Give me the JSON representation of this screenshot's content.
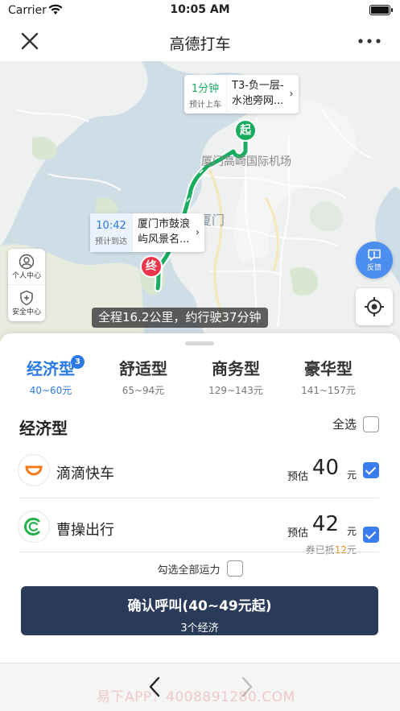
{
  "status_bar": {
    "carrier": "Carrier",
    "time": "10:05 AM"
  },
  "nav": {
    "title": "高德打车"
  },
  "map": {
    "pickup_callout": {
      "eta": "1分钟",
      "eta_label": "预计上车",
      "place_line1": "T3-负一层-",
      "place_line2": "水池旁网..."
    },
    "dropoff_callout": {
      "time": "10:42",
      "time_label": "预计到达",
      "place_line1": "厦门市鼓浪",
      "place_line2": "屿风景名..."
    },
    "start_marker": "起",
    "end_marker": "终",
    "label_airport": "厦门高崎国际机场",
    "label_city": "厦门",
    "personal_center": "个人中心",
    "safety_center": "安全中心",
    "feedback": "反馈",
    "route_summary": "全程16.2公里，约行驶37分钟"
  },
  "tabs": [
    {
      "name": "经济型",
      "price": "40~60元",
      "badge": "3",
      "active": true
    },
    {
      "name": "舒适型",
      "price": "65~94元"
    },
    {
      "name": "商务型",
      "price": "129~143元"
    },
    {
      "name": "豪华型",
      "price": "141~157元"
    }
  ],
  "section": {
    "title": "经济型",
    "select_all": "全选"
  },
  "providers": [
    {
      "name": "滴滴快车",
      "est_label": "预估",
      "amount": "40",
      "unit": "元",
      "checked": true
    },
    {
      "name": "曹操出行",
      "est_label": "预估",
      "amount": "42",
      "unit": "元",
      "checked": true,
      "coupon_prefix": "券已抵",
      "coupon_amount": "12",
      "coupon_suffix": "元"
    }
  ],
  "all_transport": "勾选全部运力",
  "confirm": {
    "main": "确认呼叫(40~49元起)",
    "sub": "3个经济"
  },
  "watermark": "易下APP：4008891280.COM",
  "colors": {
    "accent": "#2a79e6",
    "route": "#1aad5f",
    "confirm_bg": "#293b58",
    "end_marker": "#e8364a"
  }
}
